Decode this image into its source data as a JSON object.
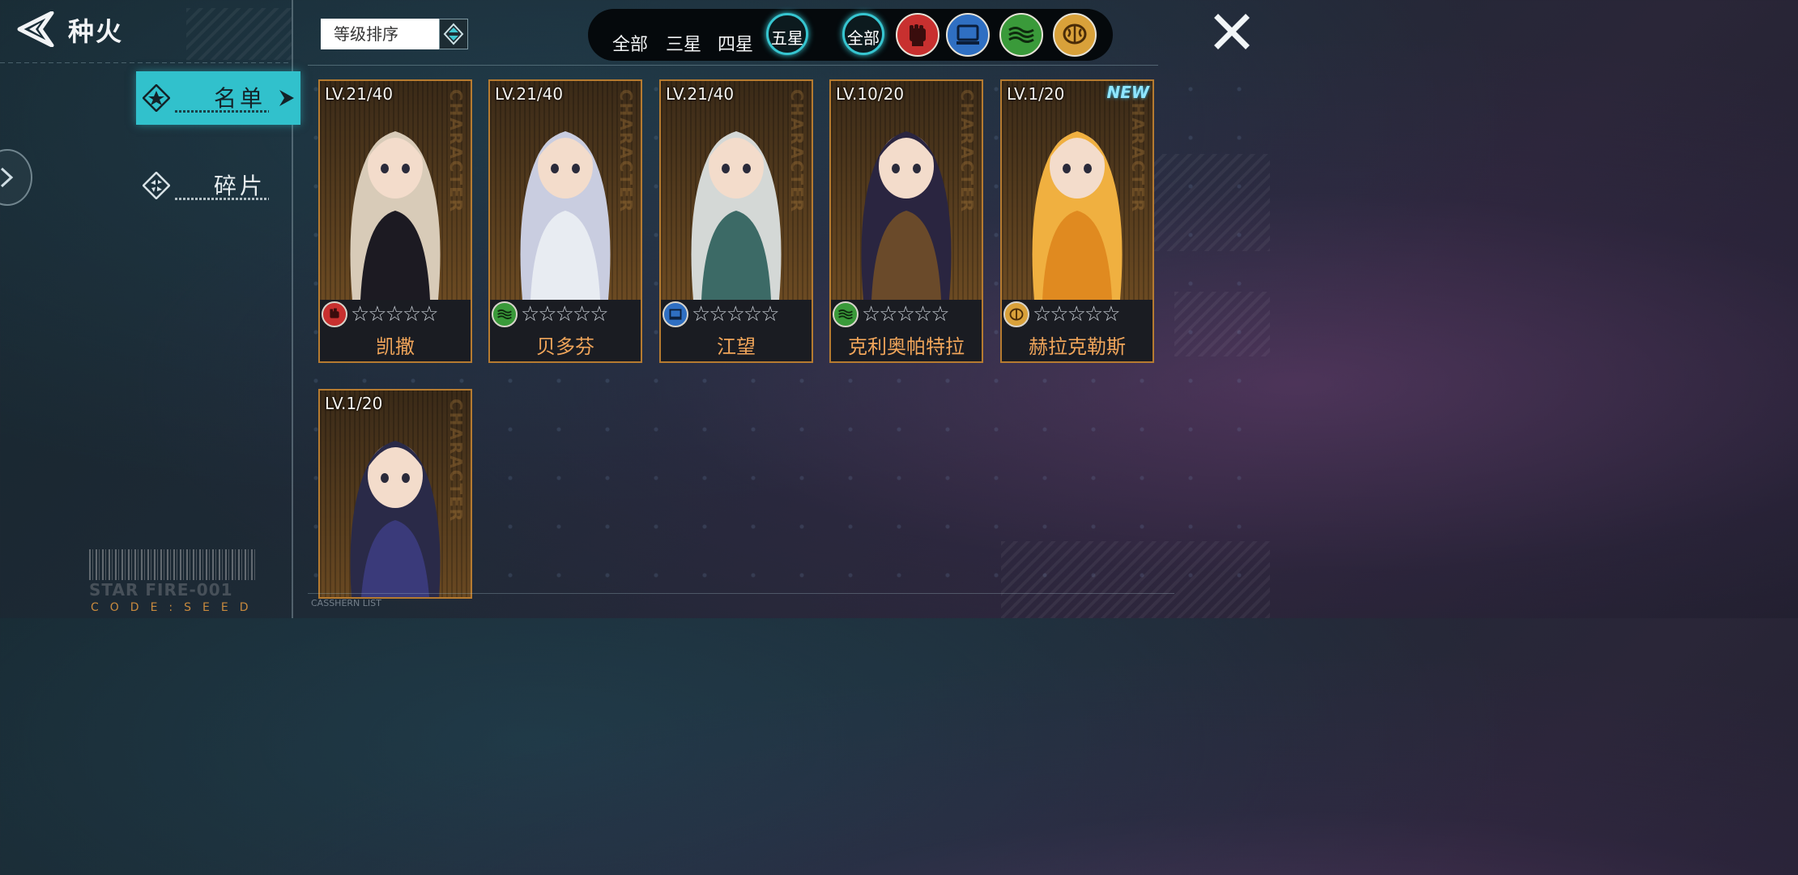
{
  "header": {
    "title": "种火"
  },
  "sidebar": {
    "items": [
      {
        "label": "名单",
        "active": true
      },
      {
        "label": "碎片",
        "active": false
      }
    ]
  },
  "sort": {
    "label": "等级排序"
  },
  "filters": {
    "stars": [
      "全部",
      "三星",
      "四星",
      "五星"
    ],
    "selected_star": "五星",
    "attribute_all": "全部",
    "attributes": [
      {
        "icon": "fist-icon",
        "color": "#c8302f"
      },
      {
        "icon": "computer-icon",
        "color": "#2f6fc2"
      },
      {
        "icon": "wave-icon",
        "color": "#3a9a3a"
      },
      {
        "icon": "brain-icon",
        "color": "#d9a13a"
      }
    ]
  },
  "characters": [
    {
      "name": "凯撒",
      "level": "LV.21/40",
      "attribute_icon": "fist-icon",
      "attribute_color": "#c8302f",
      "stars": "☆☆☆☆☆",
      "new": ""
    },
    {
      "name": "贝多芬",
      "level": "LV.21/40",
      "attribute_icon": "wave-icon",
      "attribute_color": "#3a9a3a",
      "stars": "☆☆☆☆☆",
      "new": ""
    },
    {
      "name": "江望",
      "level": "LV.21/40",
      "attribute_icon": "computer-icon",
      "attribute_color": "#2f6fc2",
      "stars": "☆☆☆☆☆",
      "new": ""
    },
    {
      "name": "克利奥帕特拉",
      "level": "LV.10/20",
      "attribute_icon": "wave-icon",
      "attribute_color": "#3a9a3a",
      "stars": "☆☆☆☆☆",
      "new": ""
    },
    {
      "name": "赫拉克勒斯",
      "level": "LV.1/20",
      "attribute_icon": "brain-icon",
      "attribute_color": "#d9a13a",
      "stars": "☆☆☆☆☆",
      "new": "NEW"
    },
    {
      "name": "",
      "level": "LV.1/20",
      "attribute_icon": "",
      "attribute_color": "",
      "stars": "",
      "new": ""
    }
  ],
  "card_watermark": "CHARACTER",
  "decor": {
    "starfire": "STAR FIRE-001",
    "code": "CODE:SEED",
    "list_tag": "CASSHERN LIST"
  }
}
